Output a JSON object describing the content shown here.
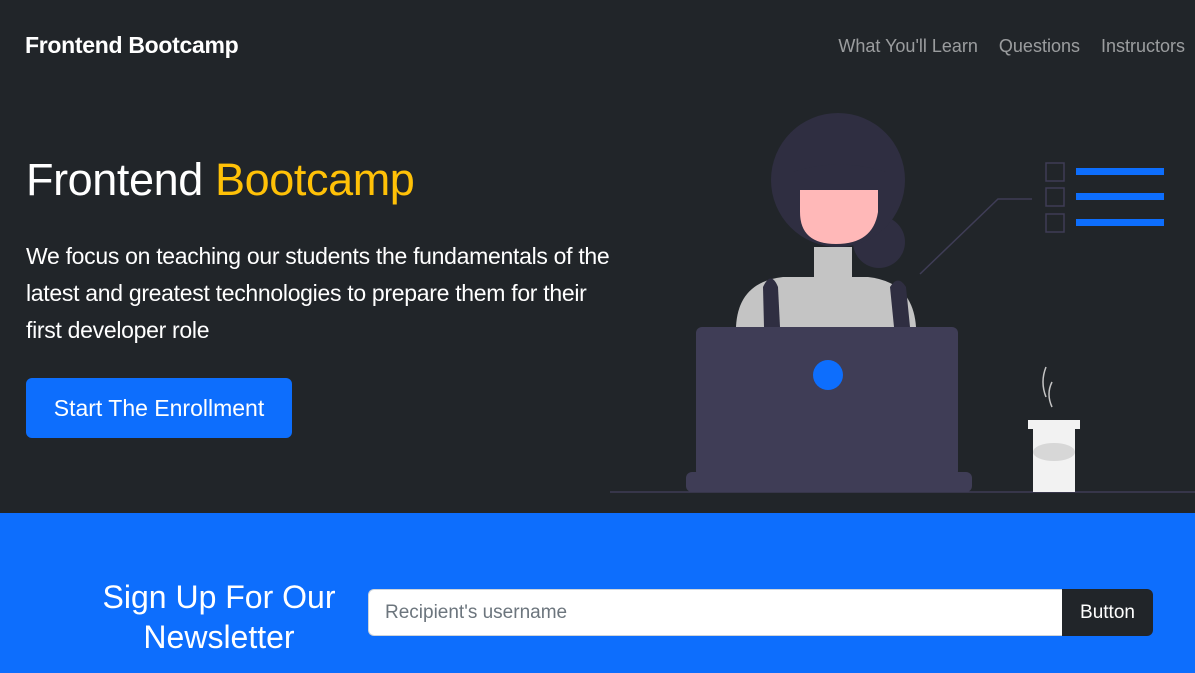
{
  "navbar": {
    "brand": "Frontend Bootcamp",
    "links": [
      {
        "label": "What You'll Learn"
      },
      {
        "label": "Questions"
      },
      {
        "label": "Instructors"
      }
    ]
  },
  "hero": {
    "title_prefix": "Frontend ",
    "title_accent": "Bootcamp",
    "lead": "We focus on teaching our students the fundamentals of the latest and greatest technologies to prepare them for their first developer role",
    "cta_label": "Start The Enrollment"
  },
  "newsletter": {
    "title": "Sign Up For Our Newsletter",
    "input_placeholder": "Recipient's username",
    "input_value": "",
    "button_label": "Button"
  },
  "illustration": {
    "name": "woman-at-laptop-illustration",
    "colors": {
      "hair": "#2f2e41",
      "face": "#ffb8b8",
      "shirt": "#c4c4c4",
      "laptop": "#3f3d56",
      "accent": "#0d6efd",
      "cup": "#f2f2f2"
    }
  },
  "colors": {
    "background": "#212529",
    "primary": "#0d6efd",
    "accent": "#ffc107",
    "nav_link": "rgba(255,255,255,0.55)"
  }
}
